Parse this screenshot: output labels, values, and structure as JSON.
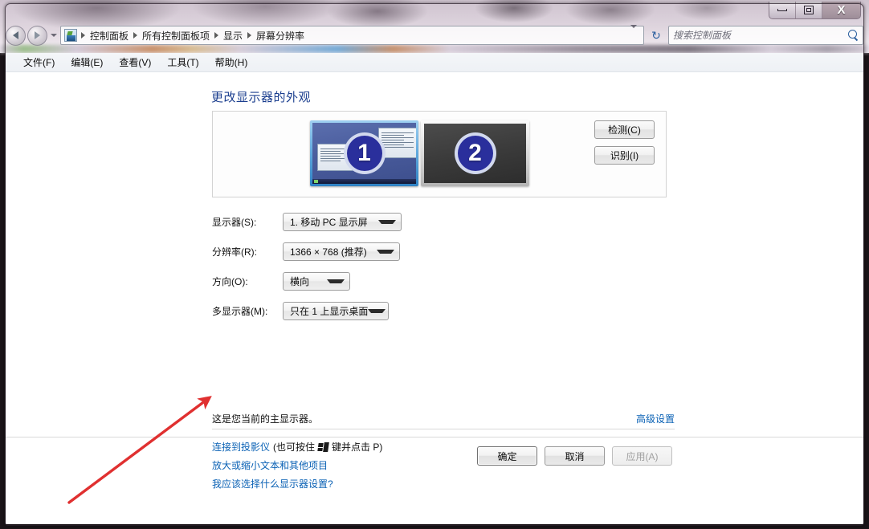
{
  "window": {
    "controls": {
      "minimize": "minimize",
      "maximize": "maximize",
      "close": "X"
    }
  },
  "navbar": {
    "back_label": "后退",
    "forward_label": "前进",
    "history_label": "最近的位置",
    "refresh_label": "↻",
    "breadcrumbs": [
      "控制面板",
      "所有控制面板项",
      "显示",
      "屏幕分辨率"
    ],
    "search": {
      "placeholder": "搜索控制面板",
      "value": ""
    }
  },
  "menubar": {
    "items": [
      "文件(F)",
      "编辑(E)",
      "查看(V)",
      "工具(T)",
      "帮助(H)"
    ]
  },
  "main": {
    "heading": "更改显示器的外观",
    "monitors": [
      {
        "number": "1",
        "selected": true
      },
      {
        "number": "2",
        "selected": false
      }
    ],
    "preview_buttons": [
      {
        "label": "检测(C)"
      },
      {
        "label": "识别(I)"
      }
    ],
    "fields": [
      {
        "label": "显示器(S):",
        "value": "1. 移动 PC 显示屏"
      },
      {
        "label": "分辨率(R):",
        "value": "1366 × 768 (推荐)"
      },
      {
        "label": "方向(O):",
        "value": "横向"
      },
      {
        "label": "多显示器(M):",
        "value": "只在 1 上显示桌面"
      }
    ],
    "primary_note": "这是您当前的主显示器。",
    "advanced_link": "高级设置",
    "links": {
      "projector_prefix": "连接到投影仪",
      "projector_mid": "(也可按住",
      "projector_suffix": "键并点击 P)",
      "text_size": "放大或缩小文本和其他项目",
      "which_settings": "我应该选择什么显示器设置?"
    },
    "actions": [
      {
        "label": "确定",
        "state": "default"
      },
      {
        "label": "取消",
        "state": "normal"
      },
      {
        "label": "应用(A)",
        "state": "disabled"
      }
    ]
  },
  "annotation": {
    "color": "#e03030",
    "points_to": "放大或缩小文本和其他项目"
  },
  "colors": {
    "link": "#0b62b5",
    "heading": "#1c3f8f",
    "selection": "#2f82c4",
    "badge": "#2a2f9c",
    "annotation": "#e03030"
  }
}
